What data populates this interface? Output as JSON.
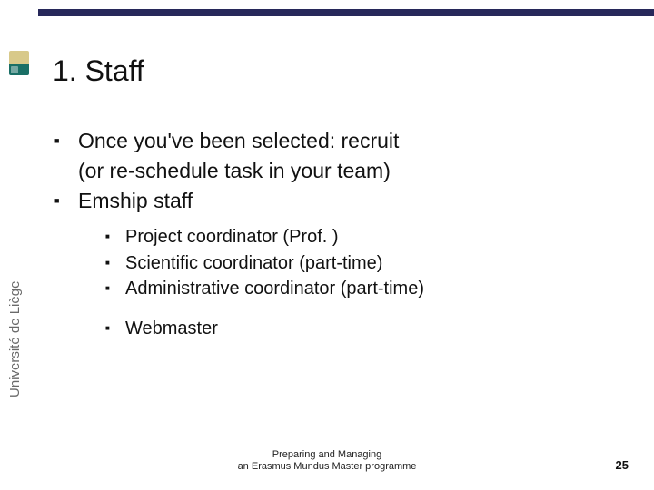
{
  "institution": "Université de Liège",
  "title": "1. Staff",
  "bullets": {
    "b1": "Once you've been selected: recruit",
    "b1_sub": "(or re-schedule task in your team)",
    "b2": "Emship staff",
    "sub": {
      "s1": "Project coordinator (Prof. )",
      "s2": "Scientific coordinator (part-time)",
      "s3": "Administrative coordinator (part-time)",
      "s4": "Webmaster"
    }
  },
  "footer": {
    "line1": "Preparing and Managing",
    "line2": "an Erasmus Mundus Master programme"
  },
  "page_number": "25"
}
